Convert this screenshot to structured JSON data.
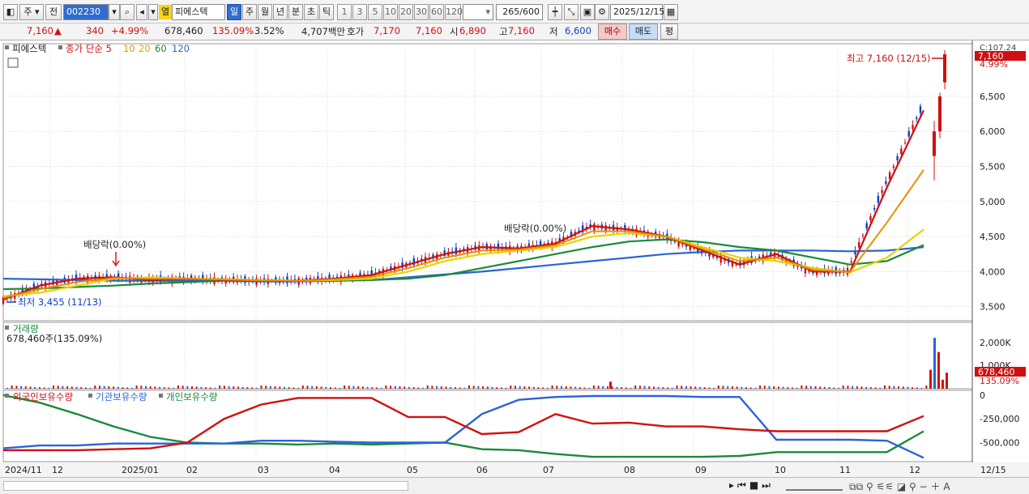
{
  "toolbar": {
    "market_label": "주",
    "prev_label": "전",
    "code": "002230",
    "fav_label": "열",
    "stock_name": "피에스텍",
    "periods": [
      "일",
      "주",
      "월",
      "년",
      "분",
      "초",
      "틱"
    ],
    "active_period": "일",
    "intervals": [
      "1",
      "3",
      "5",
      "10",
      "20",
      "30",
      "60",
      "120"
    ],
    "count": "265",
    "count_max": "/600",
    "date": "2025/12/15"
  },
  "quote": {
    "price": "7,160",
    "change": "340",
    "change_pct": "+4.99%",
    "volume": "678,460",
    "vol_ratio": "135.09%",
    "turnover": "3.52%",
    "amount": "4,707백만",
    "ask_label": "호가",
    "ask": "7,170",
    "bid": "7,160",
    "open_label": "시",
    "open": "6,890",
    "high_label": "고",
    "high": "7,160",
    "low_label": "저",
    "low": "6,600",
    "buy_label": "매수",
    "sell_label": "매도",
    "eval_label": "평"
  },
  "chart_data": {
    "type": "candlestick",
    "legend": {
      "name": "피에스텍",
      "series": [
        "종가 단순 5",
        "10",
        "20",
        "60",
        "120"
      ],
      "colors": [
        "#d01010",
        "#e89000",
        "#e8d400",
        "#1a8a3a",
        "#2a64d8"
      ]
    },
    "price_axis": [
      "6,500",
      "6,000",
      "5,500",
      "5,000",
      "4,500",
      "4,000",
      "3,500"
    ],
    "price_range": [
      3300,
      7250
    ],
    "price_labels": {
      "corner": "C:107.24",
      "current": "7,160",
      "pct": "4.99%"
    },
    "annotations": {
      "high": "최고 7,160 (12/15)",
      "low": "최저 3,455 (11/13)",
      "div1": "배당락(0.00%)",
      "div2": "배당락(0.00%)"
    },
    "volume_panel": {
      "title": "거래량",
      "info": "678,460주(135.09%)",
      "axis": [
        "2,000K",
        "1,000K"
      ],
      "current": "678,460",
      "pct": "135.09%"
    },
    "holdings_panel": {
      "series": [
        "외국인보유수량",
        "기관보유수량",
        "개인보유수량"
      ],
      "colors": [
        "#d01010",
        "#2a64d8",
        "#1a8a3a"
      ],
      "axis": [
        "0",
        "-250,000",
        "-500,000"
      ]
    },
    "x_labels": [
      "2024/11",
      "12",
      "2025/01",
      "02",
      "03",
      "04",
      "05",
      "06",
      "07",
      "08",
      "09",
      "10",
      "11",
      "12",
      "12/15"
    ],
    "ma5": [
      3600,
      3800,
      3900,
      3920,
      3880,
      3900,
      3880,
      3870,
      3870,
      3900,
      3950,
      4100,
      4250,
      4350,
      4330,
      4400,
      4650,
      4600,
      4500,
      4300,
      4100,
      4250,
      4000,
      4000,
      5200,
      6300
    ],
    "ma20": [
      3650,
      3700,
      3800,
      3900,
      3920,
      3900,
      3890,
      3880,
      3870,
      3880,
      3900,
      4000,
      4150,
      4250,
      4300,
      4350,
      4500,
      4550,
      4500,
      4350,
      4200,
      4150,
      4050,
      3990,
      4200,
      4600
    ],
    "ma60": [
      3750,
      3760,
      3780,
      3800,
      3830,
      3850,
      3870,
      3870,
      3870,
      3870,
      3880,
      3900,
      3950,
      4050,
      4150,
      4250,
      4350,
      4430,
      4460,
      4420,
      4350,
      4300,
      4200,
      4100,
      4150,
      4380
    ],
    "ma120": [
      3900,
      3890,
      3880,
      3870,
      3870,
      3870,
      3870,
      3860,
      3860,
      3870,
      3880,
      3920,
      3960,
      4000,
      4050,
      4100,
      4150,
      4200,
      4250,
      4280,
      4300,
      4300,
      4300,
      4290,
      4300,
      4350
    ],
    "foreign": [
      -580000,
      -580000,
      -580000,
      -570000,
      -560000,
      -500000,
      -250000,
      -100000,
      -30000,
      -30000,
      -30000,
      -230000,
      -230000,
      -410000,
      -390000,
      -200000,
      -300000,
      -290000,
      -330000,
      -330000,
      -360000,
      -380000,
      -380000,
      -380000,
      -380000,
      -220000
    ],
    "inst": [
      -560000,
      -530000,
      -530000,
      -510000,
      -510000,
      -510000,
      -510000,
      -480000,
      -480000,
      -490000,
      -500000,
      -500000,
      -500000,
      -200000,
      -50000,
      -20000,
      -10000,
      -10000,
      -10000,
      -20000,
      -20000,
      -470000,
      -470000,
      -470000,
      -480000,
      -660000
    ],
    "indiv": [
      0,
      -80000,
      -200000,
      -330000,
      -440000,
      -500000,
      -510000,
      -510000,
      -520000,
      -510000,
      -520000,
      -510000,
      -500000,
      -570000,
      -580000,
      -620000,
      -650000,
      -650000,
      -650000,
      -650000,
      -640000,
      -600000,
      -600000,
      -600000,
      -600000,
      -380000
    ]
  }
}
